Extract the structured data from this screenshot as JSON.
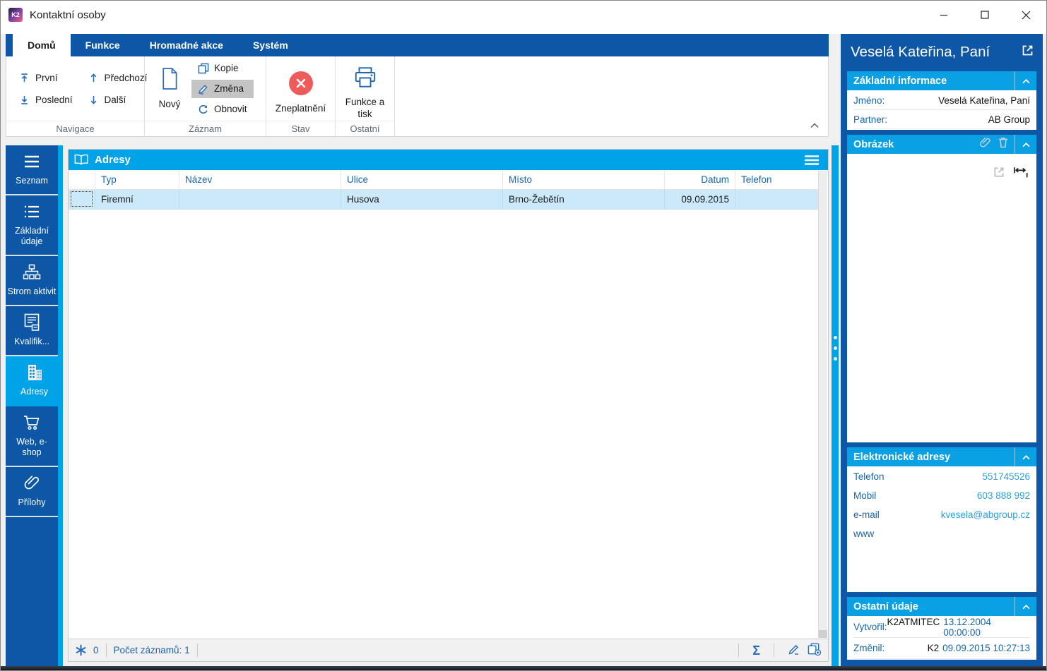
{
  "window": {
    "title": "Kontaktní osoby",
    "badge": "K2"
  },
  "ribbon": {
    "tabs": [
      {
        "label": "Domů",
        "active": true
      },
      {
        "label": "Funkce",
        "active": false
      },
      {
        "label": "Hromadné akce",
        "active": false
      },
      {
        "label": "Systém",
        "active": false
      }
    ],
    "nav": {
      "first": "První",
      "last": "Poslední",
      "prev": "Předchozí",
      "next": "Další"
    },
    "record": {
      "new": "Nový",
      "copy": "Kopie",
      "change": "Změna",
      "refresh": "Obnovit"
    },
    "state": {
      "invalidate": "Zneplatnění"
    },
    "other": {
      "print": "Funkce a tisk"
    },
    "groups": {
      "navigace": "Navigace",
      "zaznam": "Záznam",
      "stav": "Stav",
      "ostatni": "Ostatní"
    }
  },
  "sidebar": {
    "items": [
      {
        "label": "Seznam",
        "icon": "menu-icon",
        "selected": false
      },
      {
        "label": "Základní údaje",
        "icon": "list-icon",
        "selected": false
      },
      {
        "label": "Strom aktivit",
        "icon": "tree-icon",
        "selected": false
      },
      {
        "label": "Kvalifik...",
        "icon": "certificate-icon",
        "selected": false
      },
      {
        "label": "Adresy",
        "icon": "building-icon",
        "selected": true
      },
      {
        "label": "Web, e-shop",
        "icon": "cart-icon",
        "selected": false
      },
      {
        "label": "Přílohy",
        "icon": "paperclip-icon",
        "selected": false
      }
    ]
  },
  "grid": {
    "title": "Adresy",
    "columns": [
      "Typ",
      "Název",
      "Ulice",
      "Místo",
      "Datum",
      "Telefon"
    ],
    "rows": [
      [
        "Firemní",
        "",
        "Husova",
        "Brno-Žebětín",
        "09.09.2015",
        ""
      ]
    ],
    "status": {
      "flag_count": "0",
      "records": "Počet záznamů: 1",
      "sum_symbol": "Σ"
    }
  },
  "panel": {
    "title": "Veselá Kateřina, Paní",
    "basic": {
      "title": "Základní informace",
      "fields": [
        {
          "label": "Jméno:",
          "value": "Veselá Kateřina, Paní"
        },
        {
          "label": "Partner:",
          "value": "AB Group"
        }
      ]
    },
    "picture": {
      "title": "Obrázek"
    },
    "contacts": {
      "title": "Elektronické adresy",
      "fields": [
        {
          "label": "Telefon",
          "value": "551745526"
        },
        {
          "label": "Mobil",
          "value": "603 888 992"
        },
        {
          "label": "e-mail",
          "value": "kvesela@abgroup.cz"
        },
        {
          "label": "www",
          "value": ""
        }
      ]
    },
    "other": {
      "title": "Ostatní údaje",
      "fields": [
        {
          "label": "Vytvořil:",
          "user": "K2ATMITEC",
          "value": "13.12.2004 00:00:00"
        },
        {
          "label": "Změnil:",
          "user": "K2",
          "value": "09.09.2015 10:27:13"
        }
      ]
    }
  },
  "colors": {
    "dark_blue": "#0d57a6",
    "bright_blue": "#00a2e8",
    "row_highlight": "#cbe9f9",
    "label_blue": "#1565ad",
    "value_blue": "#2aa0dc",
    "invalid_red": "#ee5b5b",
    "ribbon_icon_blue": "#2a6db8"
  }
}
